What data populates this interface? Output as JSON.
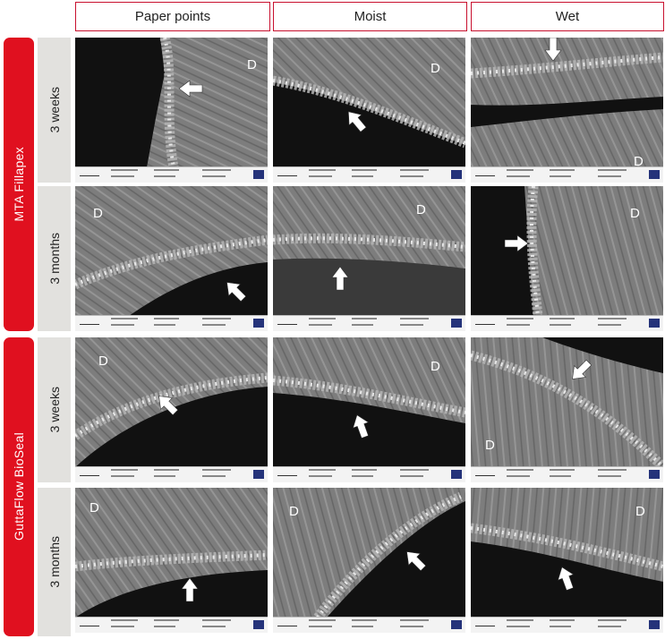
{
  "columns": [
    "Paper points",
    "Moist",
    "Wet"
  ],
  "groups": [
    "MTA Fillapex",
    "GuttaFlow BioSeal"
  ],
  "timepoints": [
    "3 weeks",
    "3 months",
    "3 weeks",
    "3 months"
  ],
  "dentin_label": "D"
}
